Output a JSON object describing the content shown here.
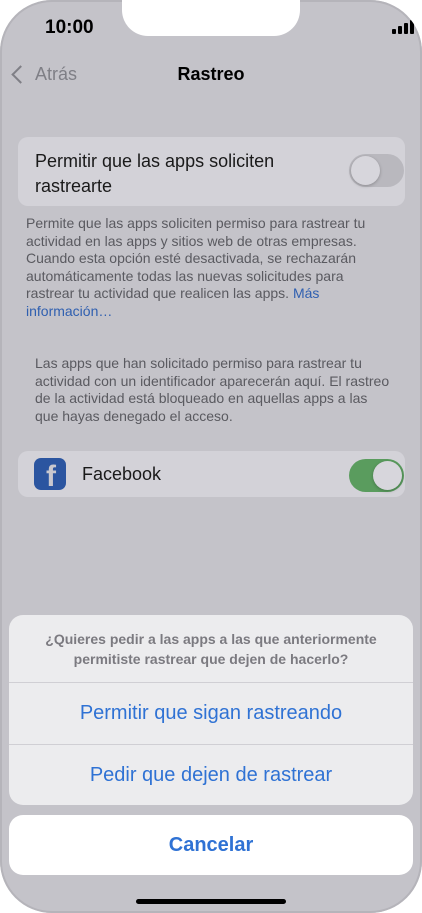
{
  "status_bar": {
    "time": "10:00"
  },
  "nav": {
    "back_label": "Atrás",
    "title": "Rastreo"
  },
  "tracking_setting": {
    "label": "Permitir que las apps soliciten rastrearte",
    "enabled": false,
    "description": "Permite que las apps soliciten permiso para rastrear tu actividad en las apps y sitios web de otras empresas. Cuando esta opción esté desactivada, se rechazarán automáticamente todas las nuevas solicitudes para rastrear tu actividad que realicen las apps.",
    "link": "Más información…"
  },
  "apps_section": {
    "description": "Las apps que han solicitado permiso para rastrear tu actividad con un identificador aparecerán aquí. El rastreo de la actividad está bloqueado en aquellas apps a las que hayas denegado el acceso.",
    "apps": [
      {
        "name": "Facebook",
        "enabled": true,
        "icon": "facebook-icon"
      }
    ]
  },
  "action_sheet": {
    "message": "¿Quieres pedir a las apps a las que anteriormente permitiste rastrear que dejen de hacerlo?",
    "options": [
      "Permitir que sigan rastreando",
      "Pedir que dejen de rastrear"
    ],
    "cancel": "Cancelar"
  },
  "colors": {
    "accent": "#2f72d4",
    "toggle_on": "#5a9c5e",
    "facebook": "#2b55a0"
  }
}
